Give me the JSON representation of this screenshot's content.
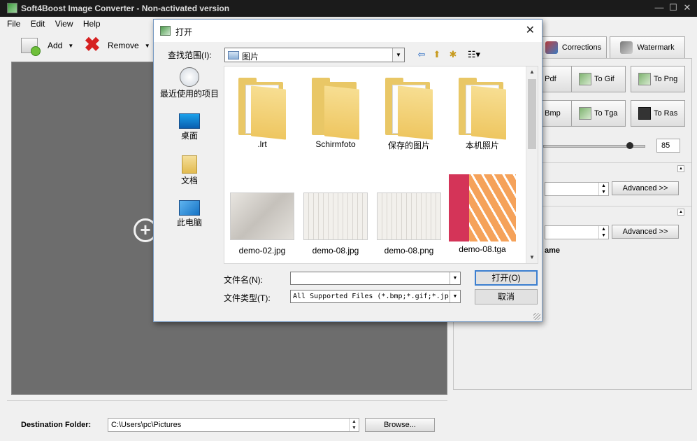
{
  "app": {
    "title": "Soft4Boost Image Converter - Non-activated version",
    "window_buttons": {
      "minimize": "—",
      "maximize": "☐",
      "close": "✕"
    }
  },
  "menu": {
    "items": [
      "File",
      "Edit",
      "View",
      "Help"
    ]
  },
  "toolbar": {
    "add_label": "Add",
    "remove_label": "Remove"
  },
  "preview": {
    "add_symbol": "+"
  },
  "destination": {
    "label": "Destination Folder:",
    "path": "C:\\Users\\pc\\Pictures",
    "browse_label": "Browse..."
  },
  "right_panel": {
    "tabs": [
      {
        "label": "Corrections",
        "icon": "corrections-icon"
      },
      {
        "label": "Watermark",
        "icon": "watermark-icon"
      }
    ],
    "formats": [
      {
        "label": "o Pdf"
      },
      {
        "label": "To Gif"
      },
      {
        "label": "To Png"
      },
      {
        "label": "o Bmp"
      },
      {
        "label": "To Tga"
      },
      {
        "label": "To Ras"
      }
    ],
    "quality_value": "85",
    "quality_fraction": 0.85,
    "advanced_label_1": "Advanced >>",
    "advanced_label_2": "Advanced >>",
    "name_label": "ame"
  },
  "dialog": {
    "title": "打开",
    "close_symbol": "✕",
    "look_in_label": "查找范围(I):",
    "look_in_value": "图片",
    "places": [
      {
        "label": "最近使用的项目",
        "icon": "recent-items-icon"
      },
      {
        "label": "桌面",
        "icon": "desktop-icon"
      },
      {
        "label": "文档",
        "icon": "documents-icon"
      },
      {
        "label": "此电脑",
        "icon": "this-pc-icon"
      }
    ],
    "files": [
      {
        "name": ".lrt",
        "kind": "folder"
      },
      {
        "name": "Schirmfoto",
        "kind": "folder"
      },
      {
        "name": "保存的图片",
        "kind": "folder"
      },
      {
        "name": "本机照片",
        "kind": "folder"
      },
      {
        "name": "demo-02.jpg",
        "kind": "image"
      },
      {
        "name": "demo-08.jpg",
        "kind": "image"
      },
      {
        "name": "demo-08.png",
        "kind": "image"
      },
      {
        "name": "demo-08.tga",
        "kind": "image"
      }
    ],
    "file_name_label": "文件名(N):",
    "file_name_value": "",
    "file_type_label": "文件类型(T):",
    "file_type_value": "All Supported Files (*.bmp;*.gif;*.jp",
    "open_label": "打开(O)",
    "cancel_label": "取消"
  }
}
